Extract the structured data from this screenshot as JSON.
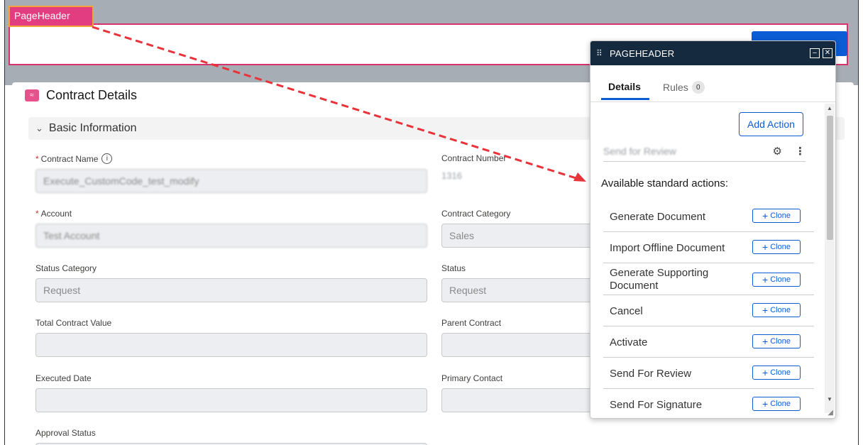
{
  "page_header": {
    "label": "PageHeader"
  },
  "card": {
    "title": "Contract Details",
    "section": "Basic Information",
    "fields": {
      "contract_name": {
        "label": "Contract Name",
        "value": "Execute_CustomCode_test_modify"
      },
      "contract_number": {
        "label": "Contract Number",
        "value": "1316"
      },
      "account": {
        "label": "Account",
        "value": "Test Account"
      },
      "contract_category": {
        "label": "Contract Category",
        "value": "Sales"
      },
      "status_category": {
        "label": "Status Category",
        "value": "Request"
      },
      "status": {
        "label": "Status",
        "value": "Request"
      },
      "total_contract_value": {
        "label": "Total Contract Value",
        "value": ""
      },
      "parent_contract": {
        "label": "Parent Contract",
        "value": ""
      },
      "executed_date": {
        "label": "Executed Date",
        "value": ""
      },
      "primary_contact": {
        "label": "Primary Contact",
        "value": ""
      },
      "approval_status": {
        "label": "Approval Status"
      }
    }
  },
  "panel": {
    "title": "PAGEHEADER",
    "tabs": {
      "details": "Details",
      "rules": "Rules",
      "rules_count": "0"
    },
    "add_action": "Add Action",
    "custom_action": "Send for Review",
    "available_label": "Available standard actions:",
    "clone_label": "Clone",
    "standard_actions": [
      "Generate Document",
      "Import Offline Document",
      "Generate Supporting Document",
      "Cancel",
      "Activate",
      "Send For Review",
      "Send For Signature"
    ]
  },
  "colors": {
    "accent": "#0b5cd5",
    "panel_header": "#152a3f",
    "page_header_tag": "#e13d80",
    "arrow": "#e8333a"
  }
}
